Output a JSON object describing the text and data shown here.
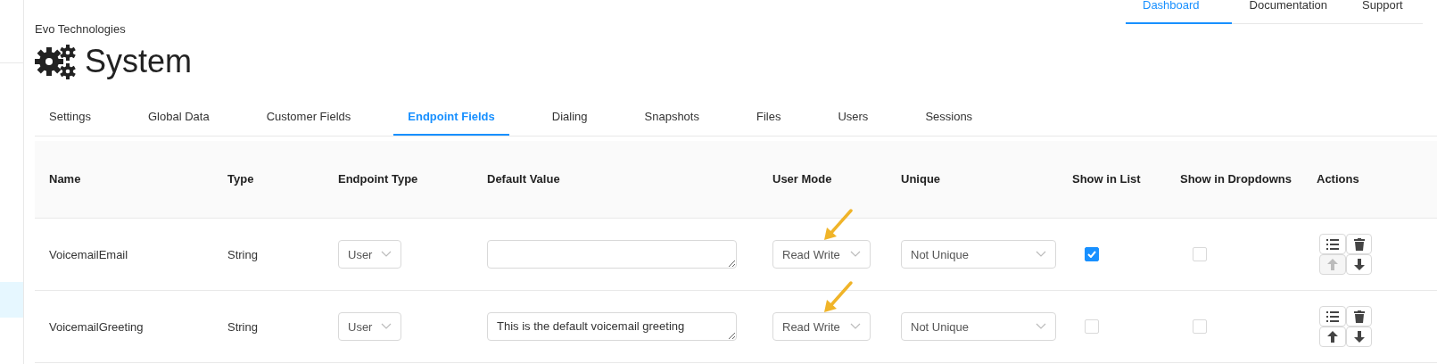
{
  "top_nav": [
    {
      "label": "Dashboard",
      "selected": true
    },
    {
      "label": "Documentation",
      "selected": false
    },
    {
      "label": "Support",
      "selected": false
    }
  ],
  "sidebar": {
    "items": [
      {
        "selected": true
      }
    ]
  },
  "header": {
    "organization": "Evo Technologies",
    "title": "System"
  },
  "tabs": [
    {
      "label": "Settings",
      "selected": false
    },
    {
      "label": "Global Data",
      "selected": false
    },
    {
      "label": "Customer Fields",
      "selected": false
    },
    {
      "label": "Endpoint Fields",
      "selected": true
    },
    {
      "label": "Dialing",
      "selected": false
    },
    {
      "label": "Snapshots",
      "selected": false
    },
    {
      "label": "Files",
      "selected": false
    },
    {
      "label": "Users",
      "selected": false
    },
    {
      "label": "Sessions",
      "selected": false
    }
  ],
  "table": {
    "columns": [
      "Name",
      "Type",
      "Endpoint Type",
      "Default Value",
      "User Mode",
      "Unique",
      "Show in List",
      "Show in Dropdowns",
      "Actions"
    ],
    "rows": [
      {
        "name": "VoicemailEmail",
        "type": "String",
        "endpoint_type": "User",
        "default_value": "",
        "user_mode": "Read Write",
        "user_mode_annotated": true,
        "unique": "Not Unique",
        "show_in_list": true,
        "show_in_dropdowns": false,
        "move_up_disabled": true,
        "move_down_disabled": false
      },
      {
        "name": "VoicemailGreeting",
        "type": "String",
        "endpoint_type": "User",
        "default_value": "This is the default voicemail greeting",
        "user_mode": "Read Write",
        "user_mode_annotated": true,
        "unique": "Not Unique",
        "show_in_list": false,
        "show_in_dropdowns": false,
        "move_up_disabled": false,
        "move_down_disabled": false
      }
    ]
  }
}
